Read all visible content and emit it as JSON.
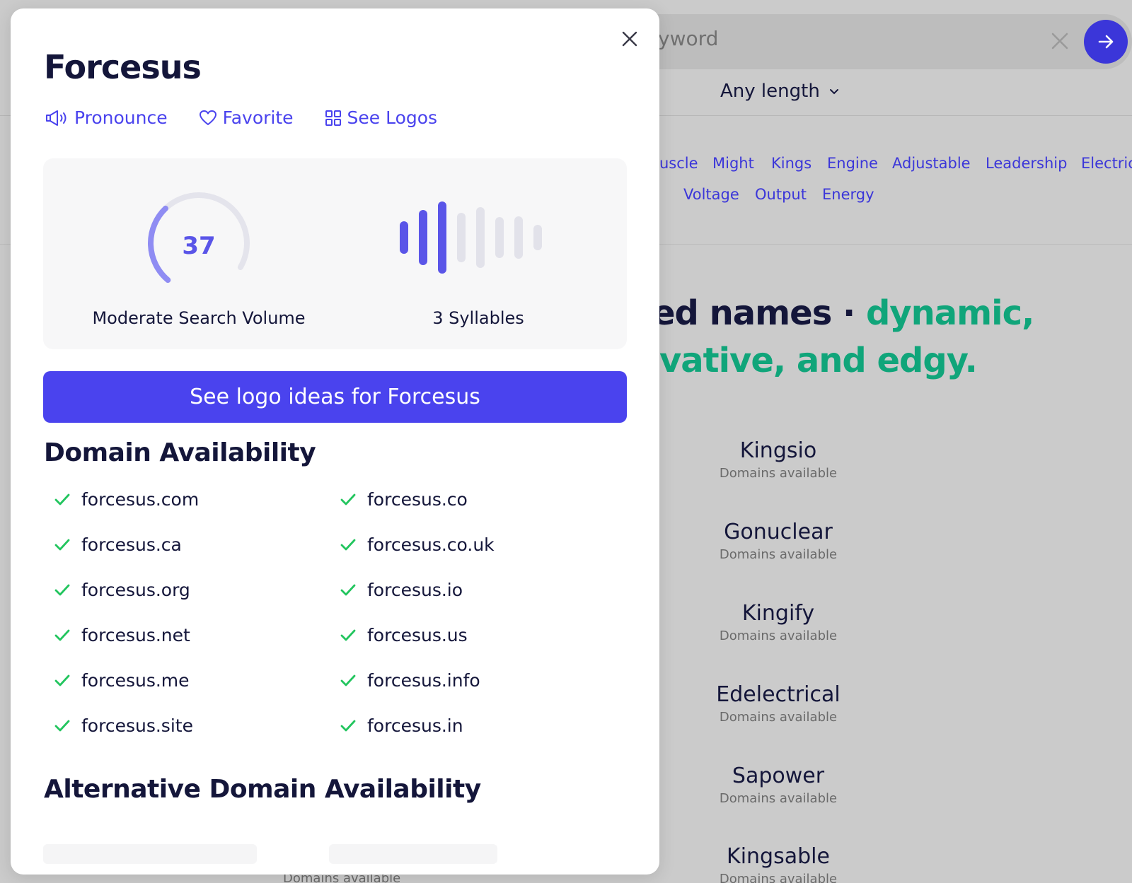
{
  "background": {
    "search": {
      "visible_text": "yword"
    },
    "length_select": "Any length",
    "tags_row1": [
      "uscle",
      "Might",
      "Kings",
      "Engine",
      "Adjustable",
      "Leadership",
      "Electric"
    ],
    "tags_row2": [
      "Voltage",
      "Output",
      "Energy"
    ],
    "heading": {
      "line1_dark": "ted names",
      "line1_sep": " · ",
      "line1_green": "dynamic,",
      "line2_green": "ovative, and edgy."
    },
    "results": [
      {
        "name": "Kingsio",
        "sub": "Domains available"
      },
      {
        "name": "Gonuclear",
        "sub": "Domains available"
      },
      {
        "name": "Kingify",
        "sub": "Domains available"
      },
      {
        "name": "Edelectrical",
        "sub": "Domains available"
      },
      {
        "name": "Sapower",
        "sub": "Domains available"
      },
      {
        "name": "Kingsable",
        "sub": "Domains available"
      }
    ],
    "peek_text": "Domains available",
    "colors": {
      "accent": "#3b36d9",
      "green": "#10a57a"
    }
  },
  "modal": {
    "title": "Forcesus",
    "actions": {
      "pronounce": "Pronounce",
      "favorite": "Favorite",
      "see_logos": "See Logos"
    },
    "search_volume": {
      "value": "37",
      "fraction": 0.37,
      "label": "Moderate Search Volume"
    },
    "syllables": {
      "count": 3,
      "label": "3 Syllables"
    },
    "cta": "See logo ideas for Forcesus",
    "domain_section_title": "Domain Availability",
    "domains_left": [
      "forcesus.com",
      "forcesus.ca",
      "forcesus.org",
      "forcesus.net",
      "forcesus.me",
      "forcesus.site"
    ],
    "domains_right": [
      "forcesus.co",
      "forcesus.co.uk",
      "forcesus.io",
      "forcesus.us",
      "forcesus.info",
      "forcesus.in"
    ],
    "alt_section_title": "Alternative Domain Availability",
    "colors": {
      "accent": "#4a43ee",
      "check": "#22c55e",
      "title": "#14163a"
    }
  }
}
